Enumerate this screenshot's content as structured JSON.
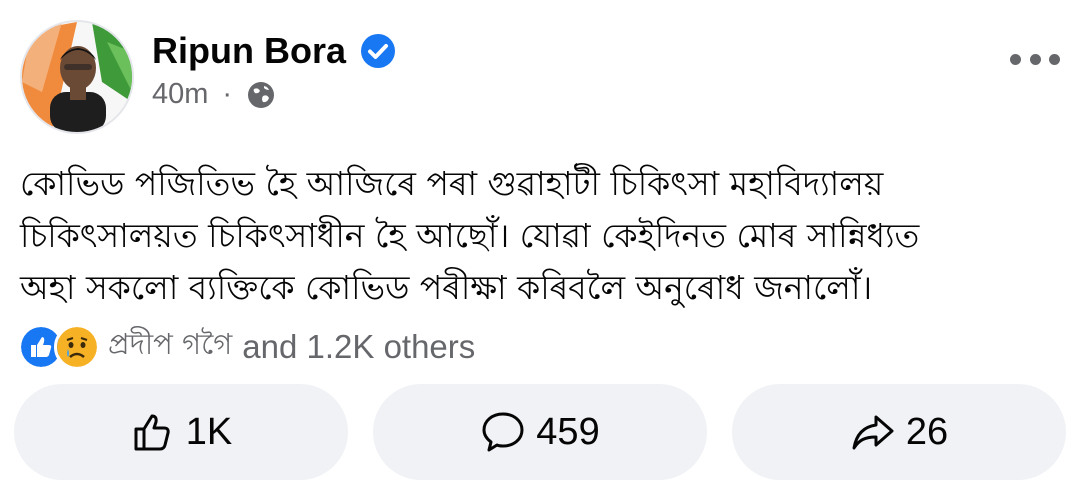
{
  "post": {
    "author": "Ripun Bora",
    "time": "40m",
    "separator": "·",
    "privacy_icon": "globe-icon",
    "verified_icon": "verified-badge-icon",
    "text": "কোভিড পজিতিভ হৈ আজিৰে পৰা গুৱাহাটী চিকিৎসা মহাবিদ্যালয়\nচিকিৎসালয়ত চিকিৎসাধীন হৈ আছোঁ। যোৱা কেইদিনত মোৰ সান্নিধ্যত\nঅহা সকলো ব্যক্তিকে কোভিড পৰীক্ষা কৰিবলৈ অনুৰোধ জনালোঁ।"
  },
  "reactions": {
    "icons": [
      "like-reaction-icon",
      "sad-reaction-icon"
    ],
    "names": "প্ৰদীপ গগৈ",
    "others": "and 1.2K others"
  },
  "actions": {
    "like_count": "1K",
    "comment_count": "459",
    "share_count": "26"
  },
  "colors": {
    "verified": "#1877f2",
    "like": "#1877f2",
    "secondary_text": "#65676b",
    "button_bg": "#f0f2f5"
  }
}
